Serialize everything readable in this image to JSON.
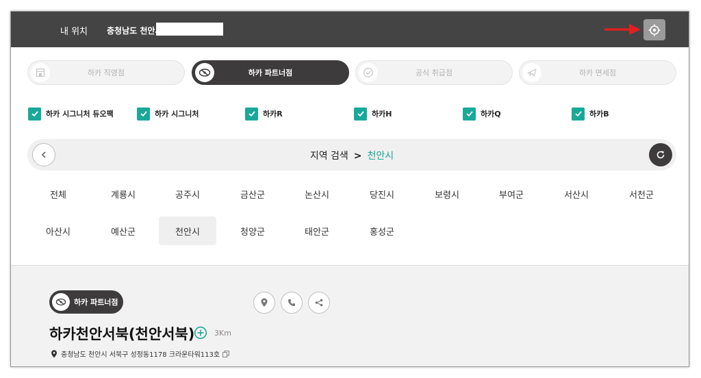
{
  "header": {
    "my_location_label": "내 위치",
    "address": "충청남도 천안시",
    "locate_button_icon": "crosshair-icon",
    "arrow_icon": "red-arrow-icon"
  },
  "store_types": [
    {
      "label": "하카 직영점",
      "icon": "store-icon",
      "active": false
    },
    {
      "label": "하카 파트너점",
      "icon": "handshake-icon",
      "active": true
    },
    {
      "label": "공식 취급점",
      "icon": "check-circle-icon",
      "active": false
    },
    {
      "label": "하카 면세점",
      "icon": "airplane-icon",
      "active": false
    }
  ],
  "filters": [
    {
      "label": "하카 시그니처 듀오팩",
      "checked": true
    },
    {
      "label": "하카 시그니처",
      "checked": true
    },
    {
      "label": "하카R",
      "checked": true
    },
    {
      "label": "하카H",
      "checked": true
    },
    {
      "label": "하카Q",
      "checked": true
    },
    {
      "label": "하카B",
      "checked": true
    }
  ],
  "region": {
    "label": "지역 검색",
    "separator": ">",
    "current": "천안시"
  },
  "districts": [
    "전체",
    "계룡시",
    "공주시",
    "금산군",
    "논산시",
    "당진시",
    "보령시",
    "부여군",
    "서산시",
    "서천군",
    "아산시",
    "예산군",
    "천안시",
    "청양군",
    "태안군",
    "홍성군"
  ],
  "selected_district": "천안시",
  "store": {
    "badge": "하카 파트너점",
    "name": "하카천안서북(천안서북)",
    "distance": "3Km",
    "address": "충청남도 천안시 서북구 성정동1178 크라운타워113호"
  },
  "colors": {
    "accent": "#1aa899",
    "dark": "#3d3b3c",
    "header": "#444444",
    "arrow": "#e02020"
  }
}
